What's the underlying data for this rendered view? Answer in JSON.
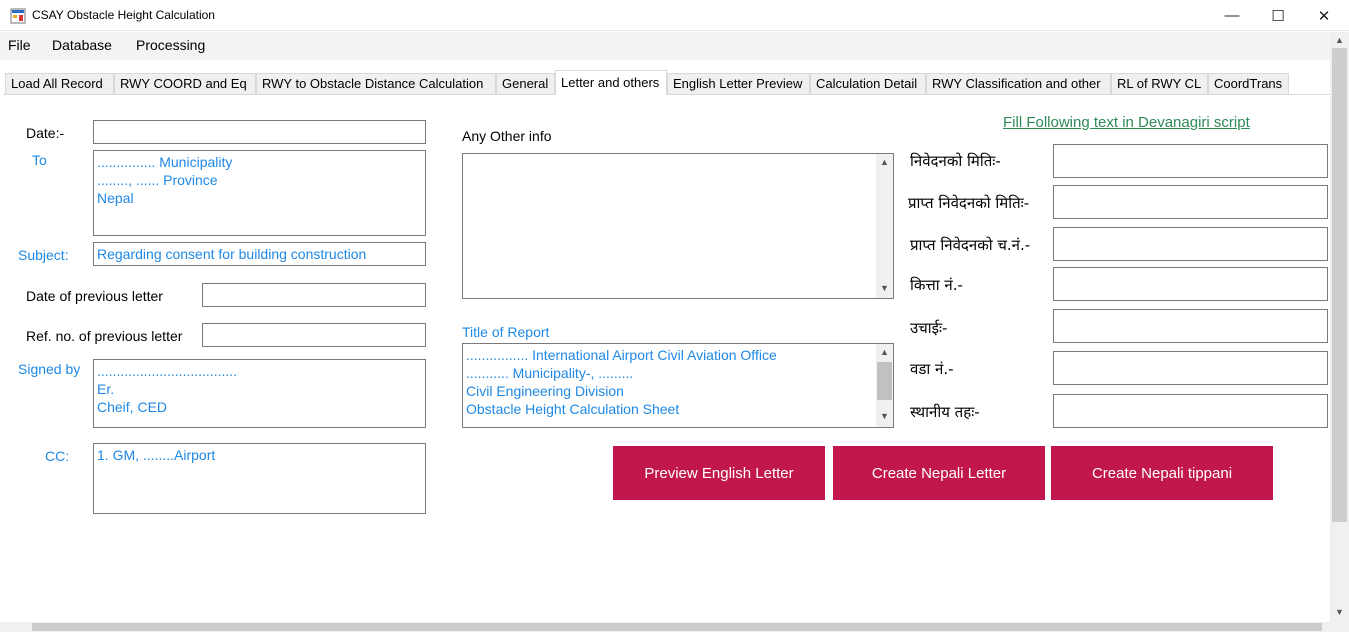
{
  "window": {
    "title": "CSAY Obstacle Height Calculation",
    "minimize": "—",
    "maximize": "☐",
    "close": "✕"
  },
  "menu": [
    "File",
    "Database",
    "Processing"
  ],
  "tabs": [
    "Load All Record",
    "RWY COORD and Eq",
    "RWY to Obstacle Distance Calculation",
    "General",
    "Letter and others",
    "English Letter Preview",
    "Calculation Detail",
    "RWY Classification and other",
    "RL of RWY CL",
    "CoordTrans"
  ],
  "active_tab": "Letter and others",
  "left": {
    "date_label": "Date:-",
    "date_value": "",
    "to_label": "To",
    "to_value": "............... Municipality\n........, ...... Province\nNepal",
    "subject_label": "Subject:",
    "subject_value": "Regarding consent for building construction",
    "prev_date_label": "Date of previous letter",
    "prev_date_value": "",
    "prev_ref_label": "Ref. no. of previous letter",
    "prev_ref_value": "",
    "signed_label": "Signed by",
    "signed_value": "....................................\nEr.\nCheif, CED",
    "cc_label": "CC:",
    "cc_value": "1. GM, ........Airport"
  },
  "middle": {
    "other_info_label": "Any Other info",
    "other_info_value": "",
    "report_title_label": "Title of Report",
    "report_title_value": "................ International Airport Civil Aviation Office\n........... Municipality-, .........\nCivil Engineering Division\nObstacle Height Calculation Sheet"
  },
  "right": {
    "hint": "Fill Following text in Devanagiri script",
    "fields": [
      {
        "label": "निवेदनको मितिः-",
        "value": ""
      },
      {
        "label": "प्राप्त निवेदनको मितिः-",
        "value": ""
      },
      {
        "label": "प्राप्त निवेदनको च.नं.-",
        "value": ""
      },
      {
        "label": "कित्ता नं.-",
        "value": ""
      },
      {
        "label": "उचाईः-",
        "value": ""
      },
      {
        "label": "वडा नं.-",
        "value": ""
      },
      {
        "label": "स्थानीय तहः-",
        "value": ""
      }
    ]
  },
  "buttons": {
    "preview_english": "Preview English Letter",
    "create_nepali_letter": "Create Nepali Letter",
    "create_nepali_tippani": "Create Nepali tippani"
  },
  "colors": {
    "accent_button": "#c2174d",
    "field_text": "#1e88e5",
    "hint_text": "#2e8b57"
  }
}
